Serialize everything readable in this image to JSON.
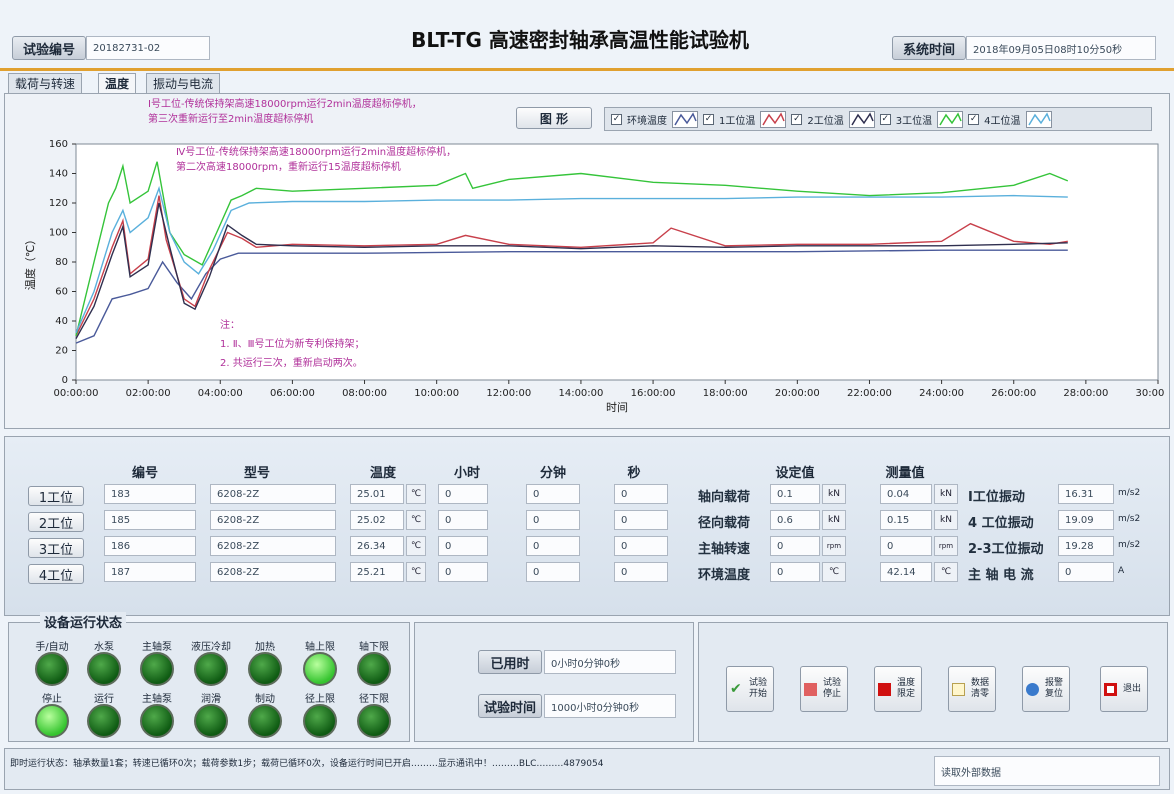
{
  "header": {
    "test_id_label": "试验编号",
    "test_id_value": "20182731-02",
    "title": "BLT-TG 高速密封轴承高温性能试验机",
    "sys_time_label": "系统时间",
    "sys_time_value": "2018年09月05日08时10分50秒"
  },
  "tabs": [
    "载荷与转速",
    "温度",
    "振动与电流"
  ],
  "graph_button": "图 形",
  "legend": [
    {
      "label": "环境温度",
      "color": "#4a5a9a",
      "checked": true
    },
    {
      "label": "1工位温",
      "color": "#c8404b",
      "checked": true
    },
    {
      "label": "2工位温",
      "color": "#2f2f4f",
      "checked": true
    },
    {
      "label": "3工位温",
      "color": "#35c43a",
      "checked": true
    },
    {
      "label": "4工位温",
      "color": "#5ab0dc",
      "checked": true
    }
  ],
  "annotations": {
    "a1": [
      "Ⅰ号工位-传统保持架高速18000rpm运行2min温度超标停机，",
      "第三次重新运行至2min温度超标停机"
    ],
    "a2": [
      "Ⅳ号工位-传统保持架高速18000rpm运行2min温度超标停机，",
      "第二次高速18000rpm，重新运行15温度超标停机"
    ],
    "note": [
      "注：",
      "1. Ⅱ、Ⅲ号工位为新专利保持架；",
      "2. 共运行三次，重新启动两次。"
    ]
  },
  "chart_data": {
    "type": "line",
    "xlabel": "时间",
    "ylabel": "温度（℃）",
    "xlim": [
      0,
      30
    ],
    "ylim": [
      0,
      160
    ],
    "x_ticks": [
      "00:00:00",
      "02:00:00",
      "04:00:00",
      "06:00:00",
      "08:00:00",
      "10:00:00",
      "12:00:00",
      "14:00:00",
      "16:00:00",
      "18:00:00",
      "20:00:00",
      "22:00:00",
      "24:00:00",
      "26:00:00",
      "28:00:00",
      "30:00:00"
    ],
    "y_ticks": [
      "0",
      "20",
      "40",
      "60",
      "80",
      "100",
      "120",
      "140",
      "160"
    ],
    "series": [
      {
        "name": "环境温度",
        "color": "#4a5a9a",
        "points": [
          [
            0,
            25
          ],
          [
            0.5,
            30
          ],
          [
            1,
            55
          ],
          [
            1.5,
            58
          ],
          [
            2,
            62
          ],
          [
            2.4,
            80
          ],
          [
            2.8,
            66
          ],
          [
            3.2,
            55
          ],
          [
            3.6,
            72
          ],
          [
            4,
            82
          ],
          [
            4.5,
            86
          ],
          [
            5,
            86
          ],
          [
            8,
            86
          ],
          [
            12,
            87
          ],
          [
            16,
            87
          ],
          [
            20,
            87
          ],
          [
            24,
            88
          ],
          [
            27.5,
            88
          ]
        ]
      },
      {
        "name": "1工位温",
        "color": "#c8404b",
        "points": [
          [
            0,
            30
          ],
          [
            0.5,
            55
          ],
          [
            1,
            90
          ],
          [
            1.3,
            108
          ],
          [
            1.5,
            72
          ],
          [
            2,
            82
          ],
          [
            2.3,
            125
          ],
          [
            2.5,
            95
          ],
          [
            3,
            55
          ],
          [
            3.3,
            50
          ],
          [
            3.7,
            75
          ],
          [
            4.2,
            100
          ],
          [
            4.6,
            96
          ],
          [
            5,
            90
          ],
          [
            6,
            92
          ],
          [
            8,
            91
          ],
          [
            10,
            92
          ],
          [
            10.8,
            98
          ],
          [
            12,
            92
          ],
          [
            14,
            90
          ],
          [
            16,
            93
          ],
          [
            16.5,
            103
          ],
          [
            18,
            91
          ],
          [
            20,
            92
          ],
          [
            22,
            92
          ],
          [
            24,
            94
          ],
          [
            24.8,
            106
          ],
          [
            26,
            94
          ],
          [
            27,
            92
          ],
          [
            27.5,
            94
          ]
        ]
      },
      {
        "name": "2工位温",
        "color": "#2f2f4f",
        "points": [
          [
            0,
            28
          ],
          [
            0.5,
            50
          ],
          [
            1,
            85
          ],
          [
            1.3,
            104
          ],
          [
            1.5,
            70
          ],
          [
            2,
            78
          ],
          [
            2.3,
            120
          ],
          [
            2.6,
            90
          ],
          [
            3,
            52
          ],
          [
            3.3,
            48
          ],
          [
            3.7,
            70
          ],
          [
            4.2,
            105
          ],
          [
            4.6,
            98
          ],
          [
            5,
            92
          ],
          [
            6,
            91
          ],
          [
            8,
            90
          ],
          [
            10,
            91
          ],
          [
            12,
            91
          ],
          [
            14,
            89
          ],
          [
            16,
            91
          ],
          [
            18,
            90
          ],
          [
            20,
            91
          ],
          [
            22,
            91
          ],
          [
            24,
            91
          ],
          [
            26,
            92
          ],
          [
            27.5,
            93
          ]
        ]
      },
      {
        "name": "3工位温",
        "color": "#35c43a",
        "points": [
          [
            0,
            30
          ],
          [
            0.5,
            80
          ],
          [
            0.9,
            120
          ],
          [
            1.1,
            130
          ],
          [
            1.3,
            145
          ],
          [
            1.5,
            120
          ],
          [
            2,
            128
          ],
          [
            2.25,
            148
          ],
          [
            2.6,
            100
          ],
          [
            3,
            85
          ],
          [
            3.5,
            78
          ],
          [
            3.9,
            100
          ],
          [
            4.3,
            122
          ],
          [
            4.6,
            125
          ],
          [
            5,
            130
          ],
          [
            6,
            128
          ],
          [
            8,
            130
          ],
          [
            10,
            132
          ],
          [
            10.8,
            140
          ],
          [
            11,
            130
          ],
          [
            12,
            136
          ],
          [
            14,
            140
          ],
          [
            16,
            134
          ],
          [
            18,
            132
          ],
          [
            20,
            128
          ],
          [
            22,
            125
          ],
          [
            24,
            127
          ],
          [
            26,
            132
          ],
          [
            27,
            140
          ],
          [
            27.5,
            135
          ]
        ]
      },
      {
        "name": "4工位温",
        "color": "#5ab0dc",
        "points": [
          [
            0,
            32
          ],
          [
            0.5,
            60
          ],
          [
            1,
            100
          ],
          [
            1.3,
            115
          ],
          [
            1.5,
            100
          ],
          [
            2,
            110
          ],
          [
            2.3,
            130
          ],
          [
            2.6,
            100
          ],
          [
            3,
            80
          ],
          [
            3.4,
            72
          ],
          [
            3.8,
            88
          ],
          [
            4.3,
            115
          ],
          [
            4.8,
            120
          ],
          [
            6,
            121
          ],
          [
            8,
            121
          ],
          [
            10,
            122
          ],
          [
            12,
            122
          ],
          [
            14,
            123
          ],
          [
            16,
            123
          ],
          [
            18,
            123
          ],
          [
            20,
            124
          ],
          [
            22,
            124
          ],
          [
            24,
            124
          ],
          [
            26,
            125
          ],
          [
            27.5,
            124
          ]
        ]
      }
    ]
  },
  "table": {
    "headers": {
      "id": "编号",
      "model": "型号",
      "temp": "温度",
      "hour": "小时",
      "minute": "分钟",
      "second": "秒",
      "setval": "设定值",
      "measval": "测量值"
    },
    "rows": [
      {
        "station": "1工位",
        "id": "183",
        "model": "6208-2Z",
        "temp": "25.01",
        "unit": "℃",
        "hour": "0",
        "minute": "0",
        "second": "0"
      },
      {
        "station": "2工位",
        "id": "185",
        "model": "6208-2Z",
        "temp": "25.02",
        "unit": "℃",
        "hour": "0",
        "minute": "0",
        "second": "0"
      },
      {
        "station": "3工位",
        "id": "186",
        "model": "6208-2Z",
        "temp": "26.34",
        "unit": "℃",
        "hour": "0",
        "minute": "0",
        "second": "0"
      },
      {
        "station": "4工位",
        "id": "187",
        "model": "6208-2Z",
        "temp": "25.21",
        "unit": "℃",
        "hour": "0",
        "minute": "0",
        "second": "0"
      }
    ],
    "params": [
      {
        "label": "轴向载荷",
        "set": "0.1",
        "set_unit": "kN",
        "meas": "0.04",
        "meas_unit": "kN",
        "vib_label": "Ⅰ工位振动",
        "vib": "16.31",
        "vib_unit": "m/s2"
      },
      {
        "label": "径向载荷",
        "set": "0.6",
        "set_unit": "kN",
        "meas": "0.15",
        "meas_unit": "kN",
        "vib_label": "4 工位振动",
        "vib": "19.09",
        "vib_unit": "m/s2"
      },
      {
        "label": "主轴转速",
        "set": "0",
        "set_unit": "rpm",
        "meas": "0",
        "meas_unit": "rpm",
        "vib_label": "2-3工位振动",
        "vib": "19.28",
        "vib_unit": "m/s2"
      },
      {
        "label": "环境温度",
        "set": "0",
        "set_unit": "℃",
        "meas": "42.14",
        "meas_unit": "℃",
        "vib_label": "主 轴 电 流",
        "vib": "0",
        "vib_unit": "A"
      }
    ]
  },
  "status": {
    "title": "设备运行状态",
    "top_row": [
      {
        "label": "手/自动",
        "on": false
      },
      {
        "label": "水泵",
        "on": false
      },
      {
        "label": "主轴泵",
        "on": false
      },
      {
        "label": "液压冷却",
        "on": false
      },
      {
        "label": "加热",
        "on": false
      },
      {
        "label": "轴上限",
        "on": true
      },
      {
        "label": "轴下限",
        "on": false
      }
    ],
    "bottom_row": [
      {
        "label": "停止",
        "on": true
      },
      {
        "label": "运行",
        "on": false
      },
      {
        "label": "主轴泵",
        "on": false
      },
      {
        "label": "润滑",
        "on": false
      },
      {
        "label": "制动",
        "on": false
      },
      {
        "label": "径上限",
        "on": false
      },
      {
        "label": "径下限",
        "on": false
      }
    ]
  },
  "timing": {
    "used_label": "已用时",
    "used_value": "0小时0分钟0秒",
    "test_label": "试验时间",
    "test_value": "1000小时0分钟0秒"
  },
  "actions": [
    {
      "label": "试验开始",
      "icon": "check-icon",
      "color": "#3a9a3a"
    },
    {
      "label": "试验停止",
      "icon": "stop-icon",
      "color": "#e06060"
    },
    {
      "label": "温度限定",
      "icon": "temp-limit-icon",
      "color": "#d01010"
    },
    {
      "label": "数据清零",
      "icon": "clear-icon",
      "color": "#f0e0a0"
    },
    {
      "label": "报警复位",
      "icon": "reset-icon",
      "color": "#3a7acc"
    },
    {
      "label": "退出",
      "icon": "exit-icon",
      "color": "#d01010"
    }
  ],
  "statusbar": {
    "left": "即时运行状态：轴承数量1套；转速已循环0次；载荷参数1步；载荷已循环0次，设备运行时间已开启………显示通讯中！………BLC………4879054",
    "right": "读取外部数据"
  }
}
